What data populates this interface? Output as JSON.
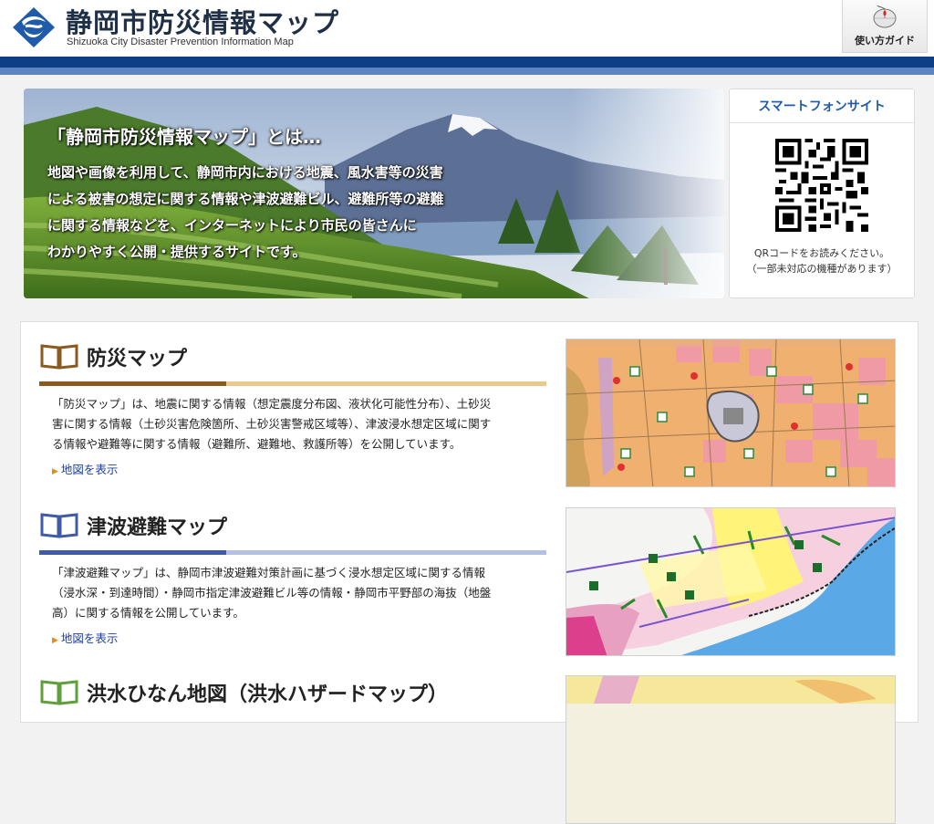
{
  "header": {
    "title": "静岡市防災情報マップ",
    "subtitle": "Shizuoka City Disaster Prevention Information Map",
    "guide_label": "使い方ガイド"
  },
  "hero": {
    "heading": "「静岡市防災情報マップ」とは…",
    "lines": [
      "地図や画像を利用して、静岡市内における地震、風水害等の災害",
      "による被害の想定に関する情報や津波避難ビル、避難所等の避難",
      "に関する情報などを、インターネットにより市民の皆さんに",
      "わかりやすく公開・提供するサイトです。"
    ]
  },
  "smartphone": {
    "title": "スマートフォンサイト",
    "note_lines": [
      "QRコードをお読みください。",
      "（一部未対応の機種があります）"
    ]
  },
  "sections": [
    {
      "title": "防災マップ",
      "color": "#8a5a1e",
      "desc_lines": [
        "「防災マップ」は、地震に関する情報（想定震度分布図、液状化可能性分布）、土砂災",
        "害に関する情報（土砂災害危険箇所、土砂災害警戒区域等）、津波浸水想定区域に関す",
        "る情報や避難等に関する情報（避難所、避難地、救護所等）を公開しています。"
      ],
      "link": "地図を表示"
    },
    {
      "title": "津波避難マップ",
      "color": "#3f5aa8",
      "desc_lines": [
        "「津波避難マップ」は、静岡市津波避難対策計画に基づく浸水想定区域に関する情報",
        "（浸水深・到達時間）・静岡市指定津波避難ビル等の情報・静岡市平野部の海抜（地盤",
        "高）に関する情報を公開しています。"
      ],
      "link": "地図を表示"
    },
    {
      "title": "洪水ひなん地図（洪水ハザードマップ）",
      "color": "#5fa03a",
      "desc_lines": [],
      "link": ""
    }
  ],
  "colors": {
    "header_bar": "#0d3f85",
    "accent_blue": "#1f5ba8",
    "link": "#1c3f9e"
  }
}
